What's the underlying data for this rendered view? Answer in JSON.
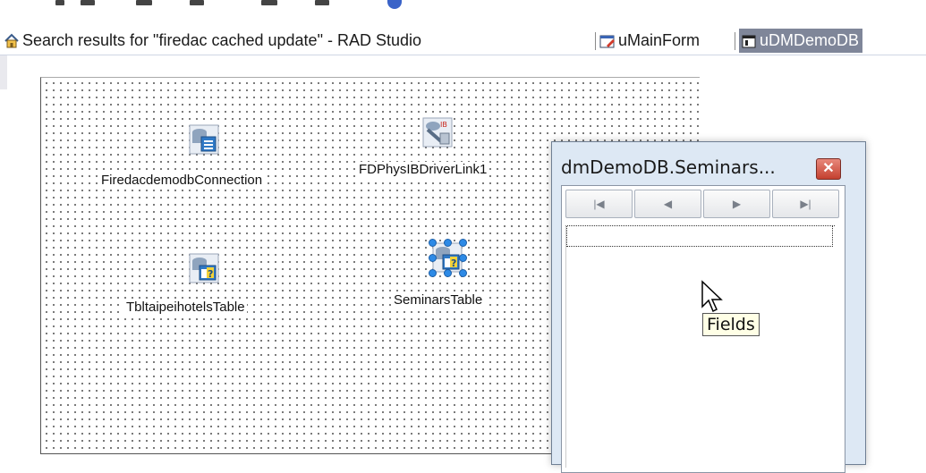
{
  "tabs": [
    {
      "label": "Search results for \"firedac cached update\" - RAD Studio",
      "icon": "home-icon"
    },
    {
      "label": "uMainForm",
      "icon": "form-edit-icon"
    },
    {
      "label": "uDMDemoDB",
      "icon": "datamodule-icon",
      "active": true
    }
  ],
  "design_surface": {
    "components": [
      {
        "label": "FiredacdemodbConnection",
        "icon": "database-connection-icon"
      },
      {
        "label": "FDPhysIBDriverLink1",
        "icon": "driver-link-icon"
      },
      {
        "label": "TbltaipeihotelsTable",
        "icon": "table-icon"
      },
      {
        "label": "SeminarsTable",
        "icon": "table-icon",
        "selected": true
      }
    ]
  },
  "fields_editor": {
    "title": "dmDemoDB.Seminars...",
    "close_label": "✕",
    "nav_buttons": [
      "first",
      "prior",
      "next",
      "last"
    ],
    "nav_glyphs": [
      "|◀",
      "◀",
      "▶",
      "▶|"
    ]
  },
  "tooltip": {
    "text": "Fields"
  },
  "colors": {
    "active_tab_bg": "#7f8699",
    "window_bg": "#dde8f4",
    "selection_handle": "#2d8ae6"
  }
}
